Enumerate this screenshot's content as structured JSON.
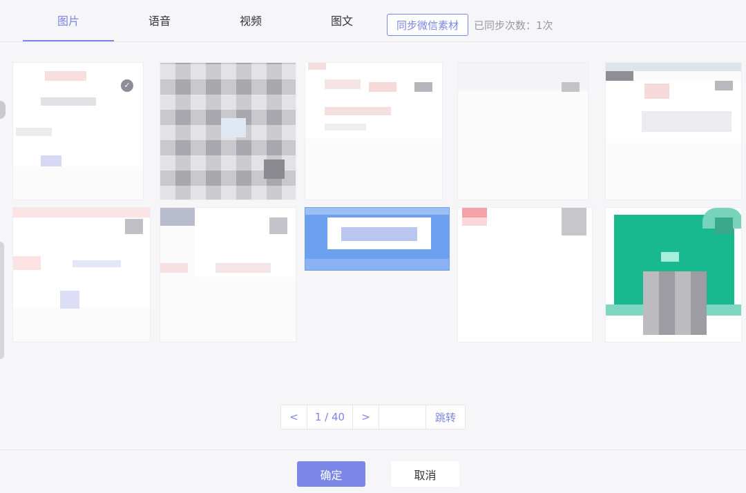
{
  "tabs": [
    {
      "label": "图片",
      "active": true
    },
    {
      "label": "语音",
      "active": false
    },
    {
      "label": "视频",
      "active": false
    },
    {
      "label": "图文",
      "active": false
    }
  ],
  "sync_button": "同步微信素材",
  "sync_count": "已同步次数：1次",
  "thumbnails": [
    {
      "selected": true
    },
    {
      "selected": false
    },
    {
      "selected": false
    },
    {
      "selected": false
    },
    {
      "selected": false
    },
    {
      "selected": false
    },
    {
      "selected": false
    },
    {
      "selected": false
    },
    {
      "selected": false
    },
    {
      "selected": false
    }
  ],
  "pagination": {
    "prev": "<",
    "page_info": "1 / 40",
    "next": ">",
    "jump_input_value": "",
    "jump_label": "跳转"
  },
  "footer": {
    "confirm": "确定",
    "cancel": "取消"
  },
  "colors": {
    "accent": "#7b86e6",
    "background": "#f6f6f8"
  }
}
